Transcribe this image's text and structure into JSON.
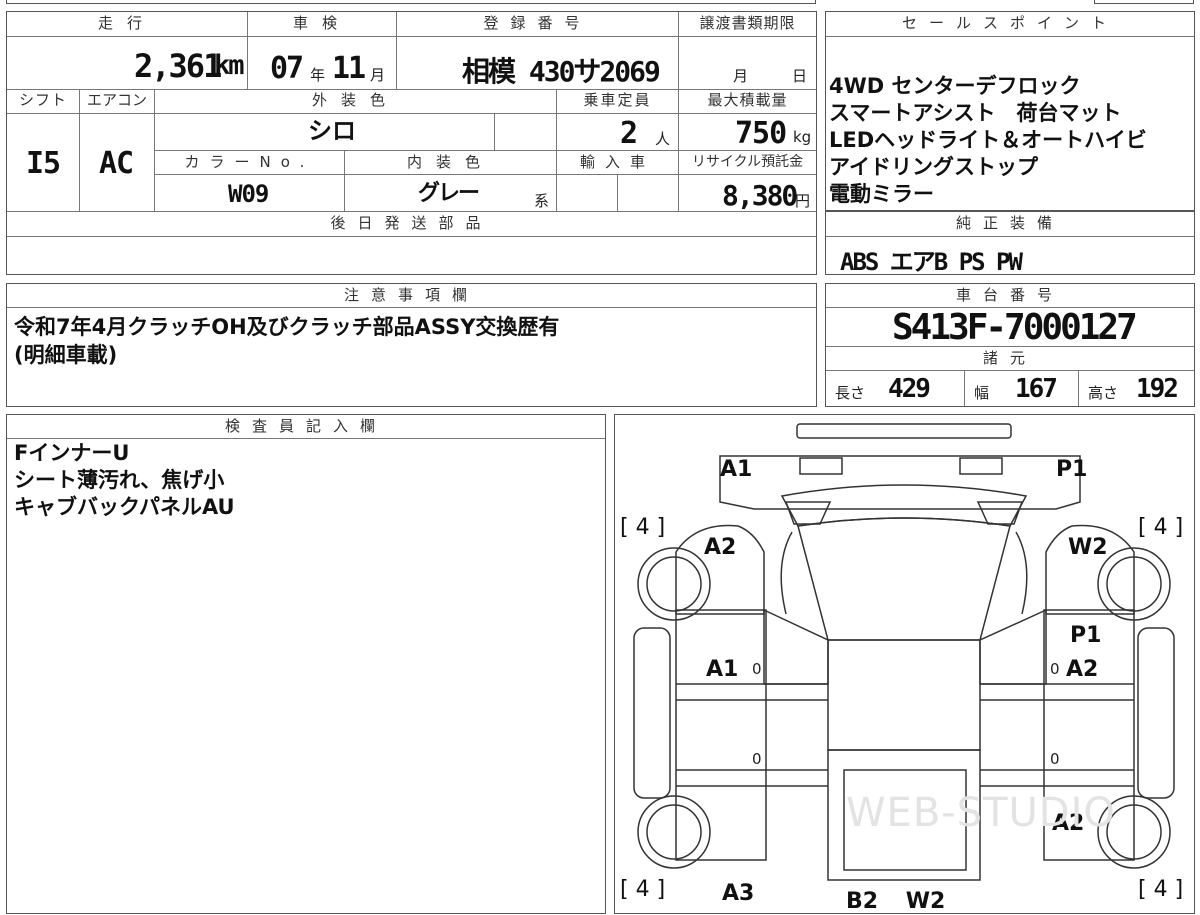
{
  "headers": {
    "mileage": "走行",
    "inspection": "車検",
    "registration": "登録番号",
    "transfer_deadline": "譲渡書類期限",
    "shift": "シフト",
    "aircon": "エアコン",
    "exterior_color": "外装色",
    "capacity": "乗車定員",
    "max_load": "最大積載量",
    "color_no": "カラーNo.",
    "interior_color": "内装色",
    "imported": "輸入車",
    "recycle_fee": "リサイクル預託金",
    "later_parts": "後日発送部品",
    "notes": "注意事項欄",
    "sales_points": "セールスポイント",
    "standard_equipment": "純正装備",
    "chassis_no": "車台番号",
    "specs": "諸元",
    "inspector": "検査員記入欄"
  },
  "vehicle": {
    "mileage_value": "2,361",
    "mileage_unit": "km",
    "inspection_year": "07",
    "year_unit": "年",
    "inspection_month": "11",
    "month_unit": "月",
    "registration_number": "相模 430サ2069",
    "transfer_month_unit": "月",
    "transfer_day_unit": "日",
    "shift_value": "I5",
    "aircon_value": "AC",
    "exterior_color_value": "シロ",
    "capacity_value": "2",
    "capacity_unit": "人",
    "max_load_value": "750",
    "max_load_unit": "kg",
    "color_no_value": "W09",
    "interior_color_value": "グレー",
    "interior_color_suffix": "系",
    "recycle_fee_value": "8,380",
    "recycle_fee_unit": "円"
  },
  "sales_points": [
    "4WD センターデフロック",
    "スマートアシスト　荷台マット",
    "LEDヘッドライト＆オートハイビ",
    "アイドリングストップ",
    "電動ミラー"
  ],
  "standard_equipment_value": "ABS エアB PS PW",
  "notes_lines": [
    "令和7年4月クラッチOH及びクラッチ部品ASSY交換歴有",
    "(明細車載)"
  ],
  "chassis_number": "S413F-7000127",
  "specs": {
    "length_label": "長さ",
    "length_value": "429",
    "width_label": "幅",
    "width_value": "167",
    "height_label": "高さ",
    "height_value": "192"
  },
  "inspector_notes": [
    "FインナーU",
    "シート薄汚れ、焦げ小",
    "キャブバックパネルAU"
  ],
  "diagram": {
    "marks": {
      "top_left": "A1",
      "top_right": "P1",
      "tire_fl": "[ 4 ]",
      "tire_fr": "[ 4 ]",
      "fender_left": "A2",
      "fender_right": "W2",
      "door_right_p1": "P1",
      "door_left": "A1",
      "door_right": "A2",
      "zero_1": "0",
      "zero_2": "0",
      "zero_3": "0",
      "zero_4": "0",
      "rear_right": "A2",
      "tire_rl": "[ 4 ]",
      "tire_rr": "[ 4 ]",
      "bottom_left": "A3",
      "bottom_center": "B2 W2"
    },
    "watermark": "WEB-STUDIO"
  }
}
